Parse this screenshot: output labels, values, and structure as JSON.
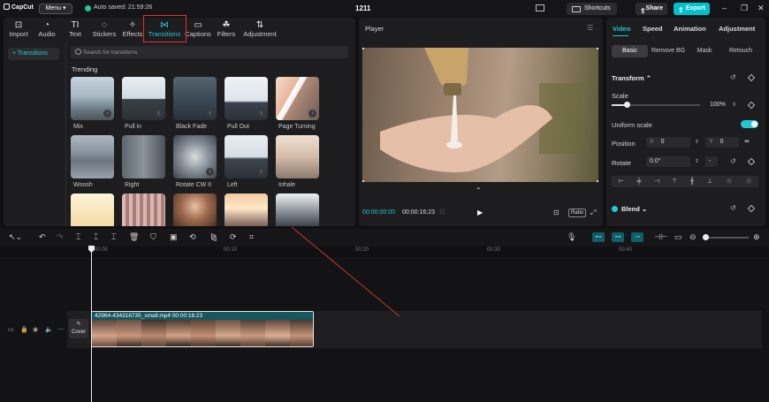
{
  "app": {
    "logo": "CapCut",
    "menu_label": "Menu",
    "autosave": "Auto saved: 21:59:26",
    "project_name": "1211"
  },
  "header": {
    "shortcuts_label": "Shortcuts",
    "share_label": "Share",
    "export_label": "Export"
  },
  "toolbar": {
    "tabs": [
      {
        "label": "Import",
        "icon": "import-icon"
      },
      {
        "label": "Audio",
        "icon": "audio-icon"
      },
      {
        "label": "Text",
        "icon": "text-icon"
      },
      {
        "label": "Stickers",
        "icon": "stickers-icon"
      },
      {
        "label": "Effects",
        "icon": "effects-icon"
      },
      {
        "label": "Transitions",
        "icon": "transitions-icon"
      },
      {
        "label": "Captions",
        "icon": "captions-icon"
      },
      {
        "label": "Filters",
        "icon": "filters-icon"
      },
      {
        "label": "Adjustment",
        "icon": "adjustment-icon"
      }
    ],
    "active": "Transitions"
  },
  "sidenav": {
    "item": "+ Transitions"
  },
  "search": {
    "placeholder": "Search for transitions"
  },
  "transitions": {
    "section": "Trending",
    "items": [
      {
        "label": "Mix"
      },
      {
        "label": "Pull in"
      },
      {
        "label": "Black Fade"
      },
      {
        "label": "Pull Out"
      },
      {
        "label": "Page Turning"
      },
      {
        "label": "Woosh"
      },
      {
        "label": "Right"
      },
      {
        "label": "Rotate CW II"
      },
      {
        "label": "Left"
      },
      {
        "label": "Inhale"
      }
    ]
  },
  "player": {
    "title": "Player",
    "timecode": "00:00:00:00",
    "duration": "00:00:16:23",
    "ratio_label": "Ratio"
  },
  "inspector": {
    "tabs": [
      "Video",
      "Speed",
      "Animation",
      "Adjustment"
    ],
    "subtabs": [
      "Basic",
      "Remove BG",
      "Mask",
      "Retouch"
    ],
    "transform_label": "Transform",
    "scale_label": "Scale",
    "scale_value": "100%",
    "scale_level": 0.17,
    "uniform_label": "Uniform scale",
    "position_label": "Position",
    "pos_x_axis": "X",
    "pos_x": "0",
    "pos_y_axis": "Y",
    "pos_y": "0",
    "rotate_label": "Rotate",
    "rotate_value": "0.0°",
    "rotate_dash": "-",
    "blend_label": "Blend"
  },
  "timeline": {
    "ruler": [
      "00:00",
      "00:10",
      "00:20",
      "00:30",
      "00:40"
    ],
    "cover_label": "Cover",
    "clip_name": "42964-434316735_small.mp4  00:00:16:23"
  },
  "colors": {
    "accent": "#23c6d3",
    "export": "#00c1cd",
    "highlight": "#dd3333"
  }
}
